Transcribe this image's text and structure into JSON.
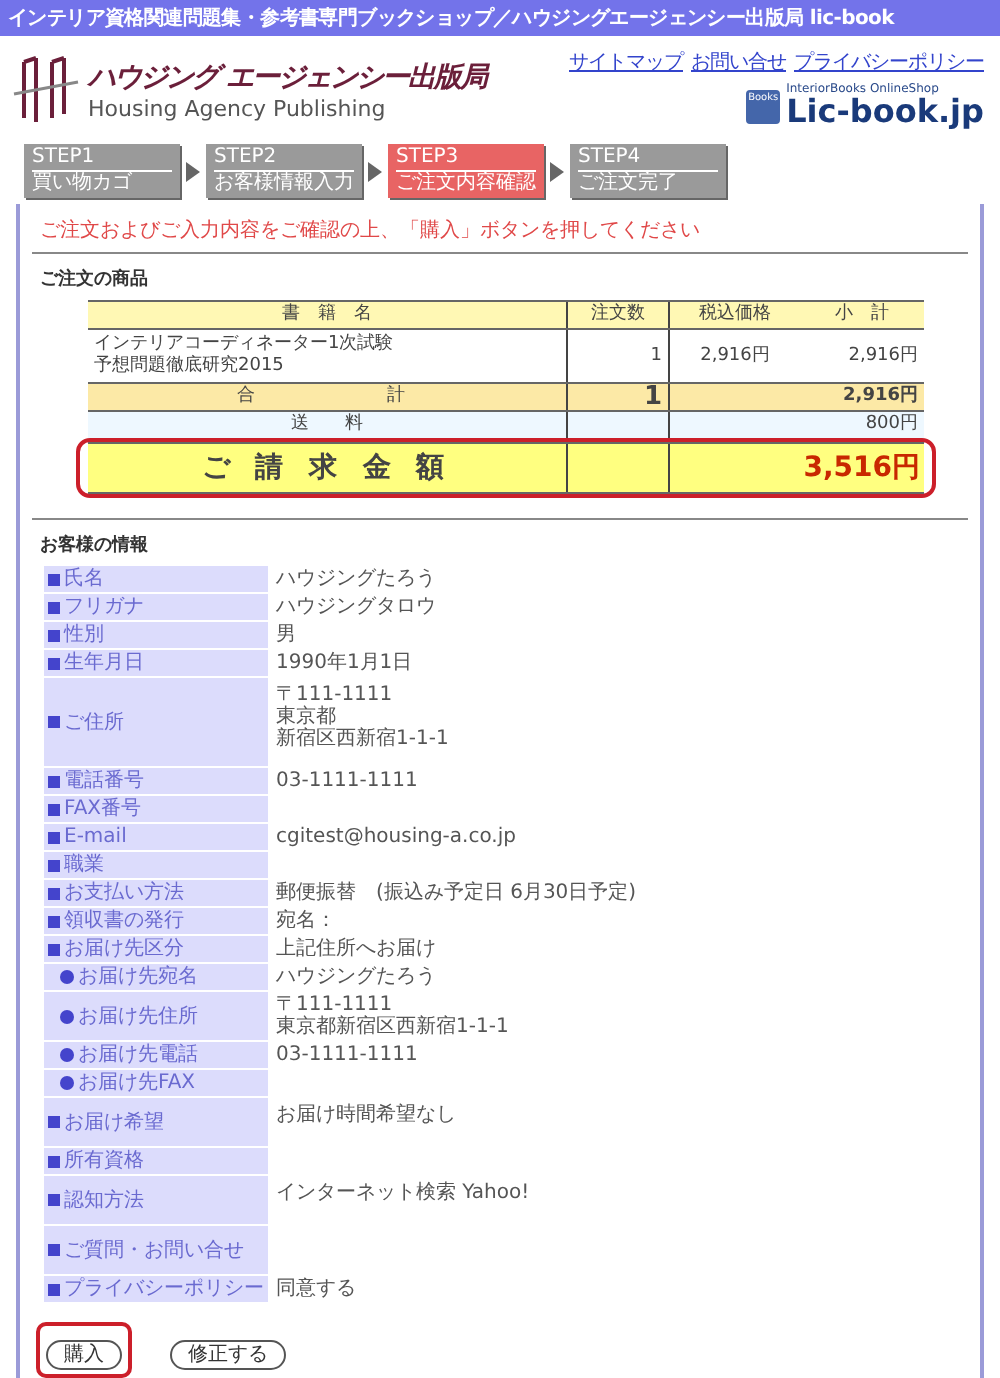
{
  "title_bar": {
    "text": "インテリア資格関連問題集・参考書専門ブックショップ／ハウジングエージェンシー出版局 lic-book"
  },
  "header": {
    "logo_title": "ハウジング エージェンシー出版局",
    "logo_subtitle": "Housing Agency Publishing",
    "links": [
      "サイトマップ",
      "お問い合せ",
      "プライバシーポリシー"
    ],
    "shop_badge": "Books",
    "shop_tagline": "InteriorBooks OnlineShop",
    "shop_name": "Lic-book.jp"
  },
  "steps": [
    {
      "step": "STEP1",
      "label": "買い物カゴ",
      "selected": false
    },
    {
      "step": "STEP2",
      "label": "お客様情報入力",
      "selected": false
    },
    {
      "step": "STEP3",
      "label": "ご注文内容確認",
      "selected": true
    },
    {
      "step": "STEP4",
      "label": "ご注文完了",
      "selected": false
    }
  ],
  "notice": "ご注文およびご入力内容をご確認の上、「購入」ボタンを押してください",
  "order": {
    "heading": "ご注文の商品",
    "columns": [
      "書　籍　名",
      "注文数",
      "税込価格",
      "小　計"
    ],
    "items": [
      {
        "title_lines": [
          "インテリアコーディネーター1次試験",
          "予想問題徹底研究2015"
        ],
        "qty": "1",
        "price": "2,916円",
        "subtotal": "2,916円"
      }
    ],
    "total": {
      "label": "合　　　　計",
      "qty": "1",
      "subtotal": "2,916円"
    },
    "shipping": {
      "label": "送　　料",
      "amount": "800円"
    },
    "grand_total": {
      "label": "ご 請 求 金 額",
      "amount": "3,516円",
      "highlighted": true
    }
  },
  "customer": {
    "heading": "お客様の情報",
    "fields": [
      {
        "kind": "main",
        "label": "氏名",
        "value": [
          "ハウジングたろう"
        ]
      },
      {
        "kind": "main",
        "label": "フリガナ",
        "value": [
          "ハウジングタロウ"
        ]
      },
      {
        "kind": "main",
        "label": "性別",
        "value": [
          "男"
        ]
      },
      {
        "kind": "main",
        "label": "生年月日",
        "value": [
          "1990年1月1日"
        ]
      },
      {
        "kind": "main",
        "label": "ご住所",
        "value": [
          "〒111-1111",
          "東京都",
          "新宿区西新宿1-1-1"
        ],
        "tall": true
      },
      {
        "kind": "main",
        "label": "電話番号",
        "value": [
          "03-1111-1111"
        ]
      },
      {
        "kind": "main",
        "label": "FAX番号"
      },
      {
        "kind": "main",
        "label": "E-mail",
        "value": [
          "cgitest@housing-a.co.jp"
        ]
      },
      {
        "kind": "main",
        "label": "職業"
      },
      {
        "kind": "main",
        "label": "お支払い方法",
        "value": [
          "郵便振替　(振込み予定日 6月30日予定)"
        ]
      },
      {
        "kind": "main",
        "label": "領収書の発行",
        "value": [
          "宛名："
        ]
      },
      {
        "kind": "main",
        "label": "お届け先区分",
        "value": [
          "上記住所へお届け"
        ]
      },
      {
        "kind": "sub",
        "label": "お届け先宛名",
        "value": [
          "ハウジングたろう"
        ]
      },
      {
        "kind": "sub",
        "label": "お届け先住所",
        "value": [
          "〒111-1111",
          "東京都新宿区西新宿1-1-1"
        ]
      },
      {
        "kind": "sub",
        "label": "お届け先電話",
        "value": [
          "03-1111-1111"
        ]
      },
      {
        "kind": "sub",
        "label": "お届け先FAX"
      },
      {
        "kind": "main",
        "label": "お届け希望",
        "value": [
          "お届け時間希望なし"
        ],
        "tall": true
      },
      {
        "kind": "main",
        "label": "所有資格"
      },
      {
        "kind": "main",
        "label": "認知方法",
        "value": [
          "インターネット検索 Yahoo!"
        ],
        "tall": true
      },
      {
        "kind": "main",
        "label": "ご質問・お問い合せ",
        "tall": true
      },
      {
        "kind": "main",
        "label": "プライバシーポリシー",
        "value": [
          "同意する"
        ]
      }
    ]
  },
  "buttons": [
    {
      "label": "購入",
      "highlighted": true
    },
    {
      "label": "修正する",
      "highlighted": false
    }
  ]
}
